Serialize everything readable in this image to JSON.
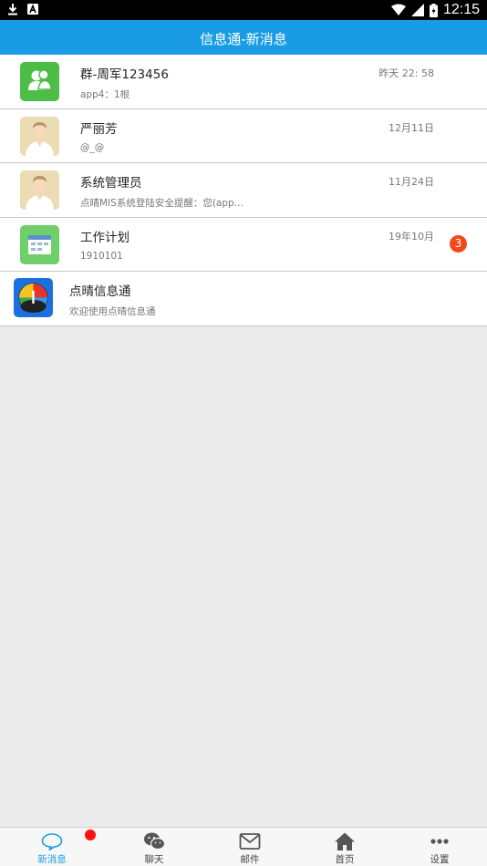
{
  "status_bar": {
    "time": "12:15",
    "icons": [
      "download-icon",
      "notification-a-icon",
      "wifi-icon",
      "signal-icon",
      "battery-icon"
    ]
  },
  "header": {
    "title": "信息通-新消息"
  },
  "messages": [
    {
      "name": "群-周军123456",
      "time": "昨天 22: 58",
      "preview": "app4：1根",
      "avatar": "group-icon"
    },
    {
      "name": "严丽芳",
      "time": "12月11日",
      "preview": "@_@",
      "avatar": "person-avatar"
    },
    {
      "name": "系统管理员",
      "time": "11月24日",
      "preview": "点晴MIS系统登陆安全提醒：您(app…",
      "avatar": "person-avatar"
    },
    {
      "name": "工作计划",
      "time": "19年10月",
      "preview": "1910101",
      "avatar": "calendar-icon",
      "badge": "3"
    },
    {
      "name": "点晴信息通",
      "time": "",
      "preview": "欢迎使用点晴信息通",
      "avatar": "app-logo"
    }
  ],
  "tabs": [
    {
      "label": "新消息",
      "icon": "chat-bubble-icon",
      "active": true
    },
    {
      "label": "聊天",
      "icon": "wechat-icon",
      "active": false
    },
    {
      "label": "邮件",
      "icon": "mail-icon",
      "active": false
    },
    {
      "label": "首页",
      "icon": "home-icon",
      "active": false
    },
    {
      "label": "设置",
      "icon": "more-dots-icon",
      "active": false
    }
  ],
  "colors": {
    "accent": "#1a9ce4",
    "badge": "#f04a1b",
    "notification_dot": "#ff1111",
    "group_green": "#4cbd47"
  }
}
